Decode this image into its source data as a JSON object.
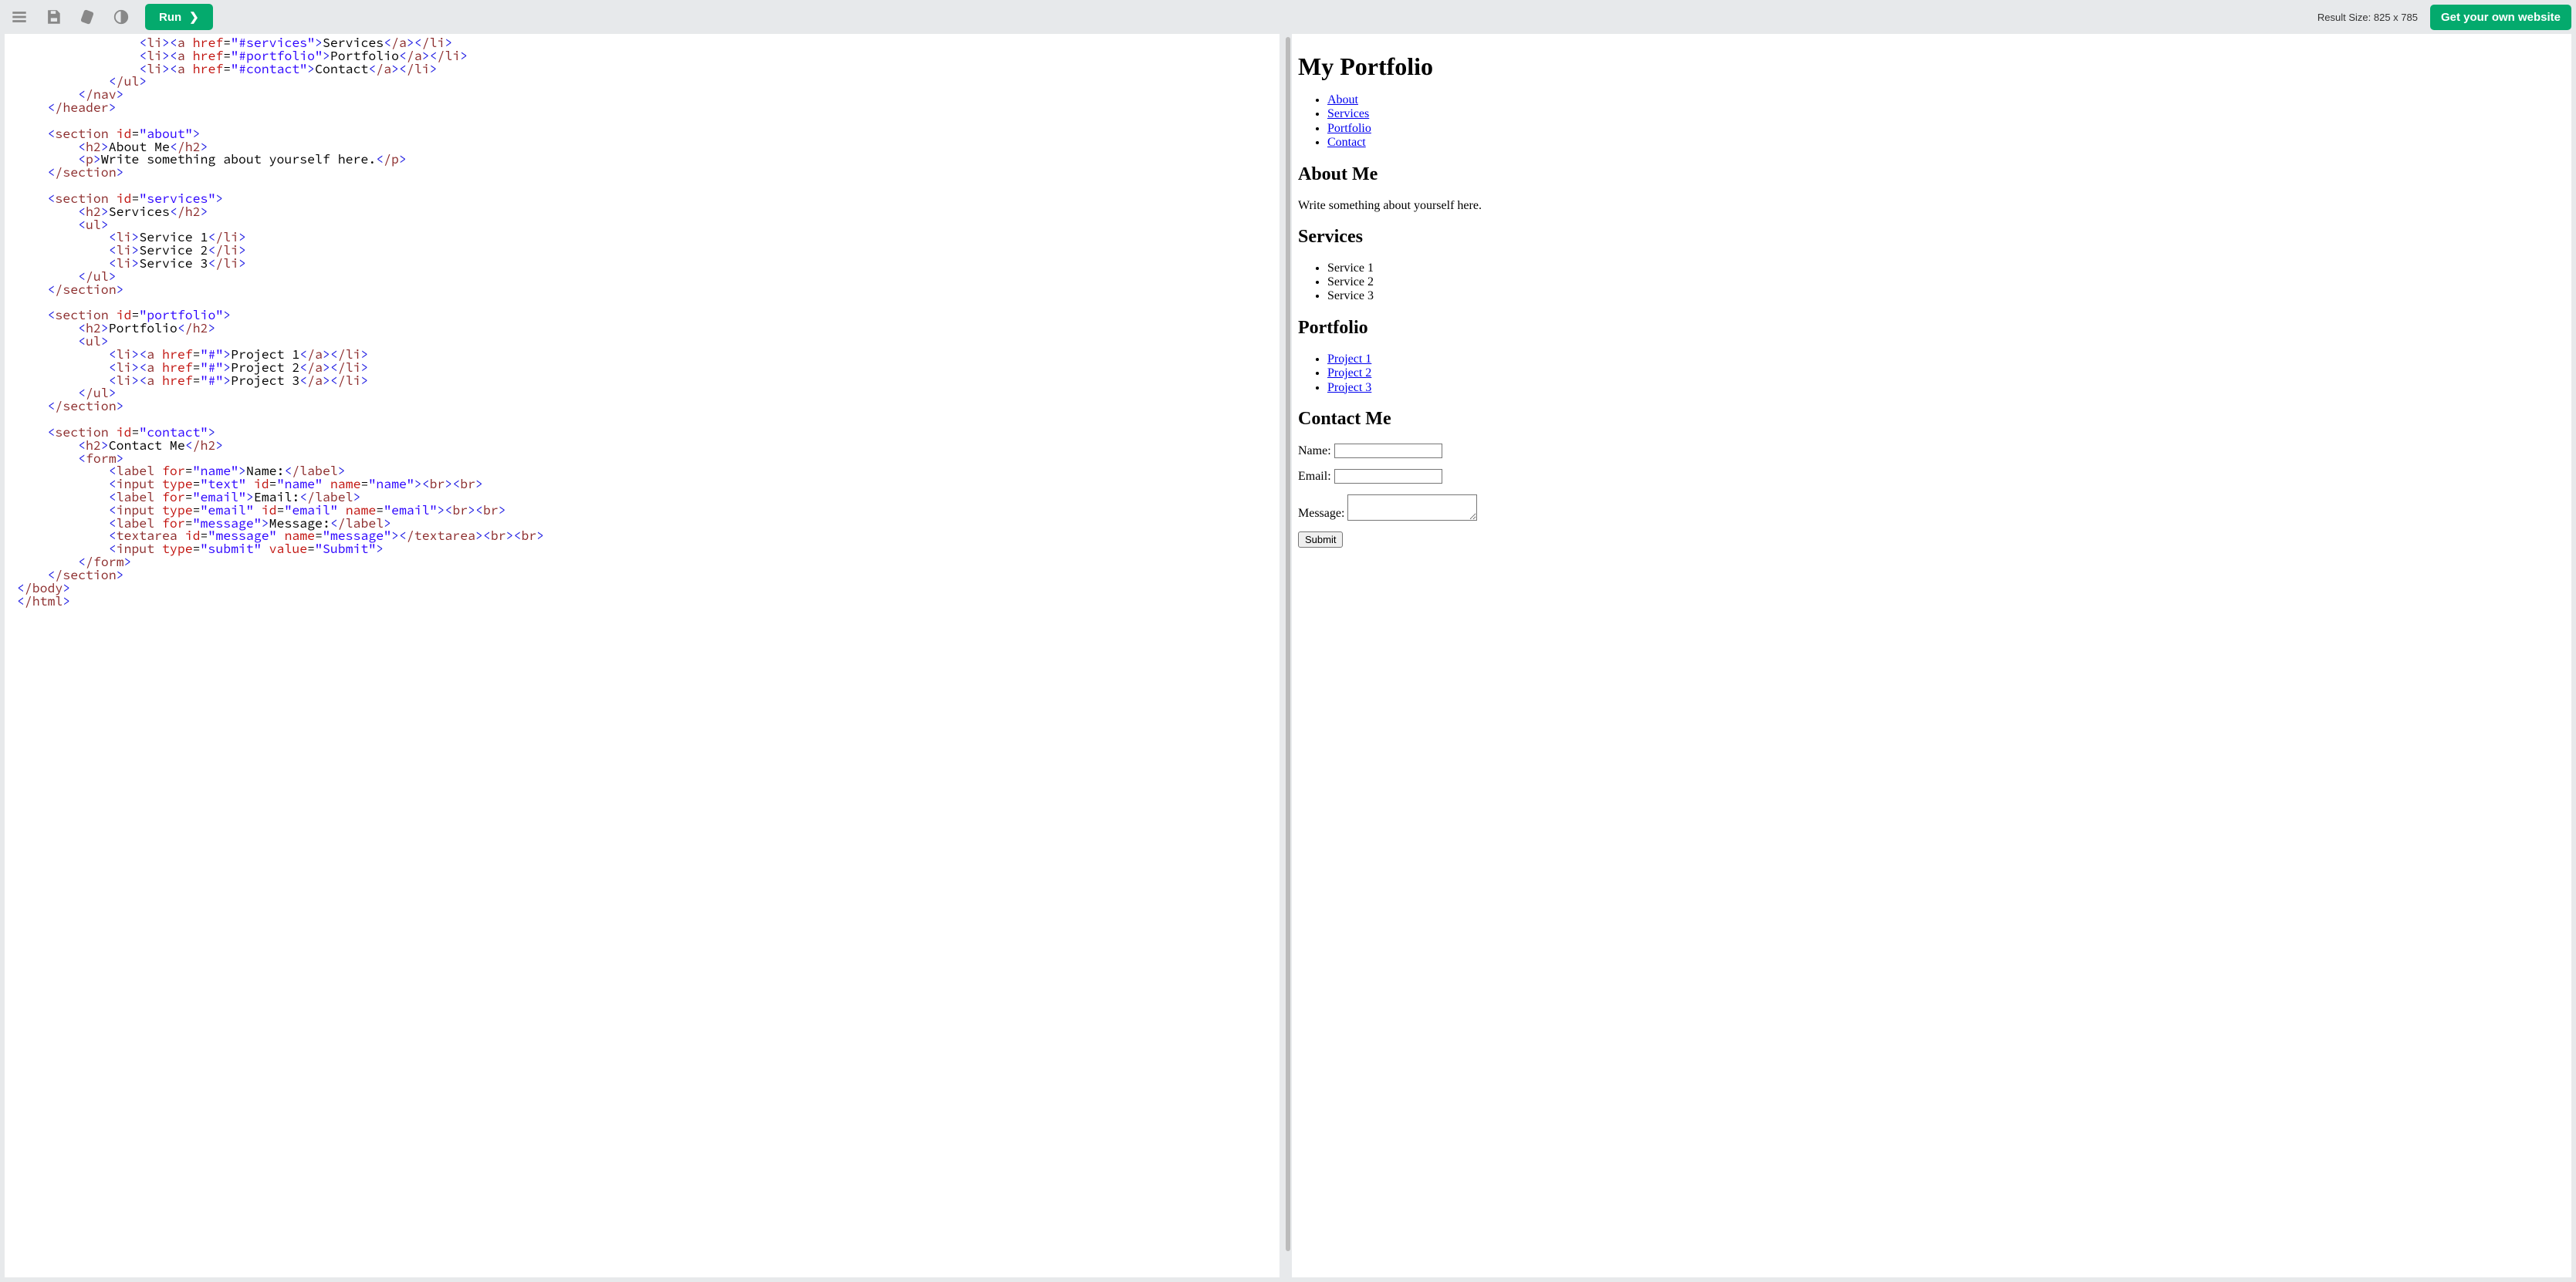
{
  "toolbar": {
    "run_label": "Run",
    "run_chevron": "❯",
    "result_size_label": "Result Size: 825 x 785",
    "get_own_label": "Get your own website"
  },
  "code": {
    "lines": [
      [
        4,
        "<",
        "li",
        "><",
        "a",
        " ",
        [
          "href"
        ],
        "=",
        "\"#services\"",
        ">",
        "Services",
        "</",
        "a",
        "></",
        "li",
        ">"
      ],
      [
        4,
        "<",
        "li",
        "><",
        "a",
        " ",
        [
          "href"
        ],
        "=",
        "\"#portfolio\"",
        ">",
        "Portfolio",
        "</",
        "a",
        "></",
        "li",
        ">"
      ],
      [
        4,
        "<",
        "li",
        "><",
        "a",
        " ",
        [
          "href"
        ],
        "=",
        "\"#contact\"",
        ">",
        "Contact",
        "</",
        "a",
        "></",
        "li",
        ">"
      ],
      [
        3,
        "</",
        "ul",
        ">"
      ],
      [
        2,
        "</",
        "nav",
        ">"
      ],
      [
        1,
        "</",
        "header",
        ">"
      ],
      [
        0,
        ""
      ],
      [
        1,
        "<",
        "section",
        " ",
        [
          "id"
        ],
        "=",
        "\"about\"",
        ">"
      ],
      [
        2,
        "<",
        "h2",
        ">",
        "About Me",
        "</",
        "h2",
        ">"
      ],
      [
        2,
        "<",
        "p",
        ">",
        "Write something about yourself here.",
        "</",
        "p",
        ">"
      ],
      [
        1,
        "</",
        "section",
        ">"
      ],
      [
        0,
        ""
      ],
      [
        1,
        "<",
        "section",
        " ",
        [
          "id"
        ],
        "=",
        "\"services\"",
        ">"
      ],
      [
        2,
        "<",
        "h2",
        ">",
        "Services",
        "</",
        "h2",
        ">"
      ],
      [
        2,
        "<",
        "ul",
        ">"
      ],
      [
        3,
        "<",
        "li",
        ">",
        "Service 1",
        "</",
        "li",
        ">"
      ],
      [
        3,
        "<",
        "li",
        ">",
        "Service 2",
        "</",
        "li",
        ">"
      ],
      [
        3,
        "<",
        "li",
        ">",
        "Service 3",
        "</",
        "li",
        ">"
      ],
      [
        2,
        "</",
        "ul",
        ">"
      ],
      [
        1,
        "</",
        "section",
        ">"
      ],
      [
        0,
        ""
      ],
      [
        1,
        "<",
        "section",
        " ",
        [
          "id"
        ],
        "=",
        "\"portfolio\"",
        ">"
      ],
      [
        2,
        "<",
        "h2",
        ">",
        "Portfolio",
        "</",
        "h2",
        ">"
      ],
      [
        2,
        "<",
        "ul",
        ">"
      ],
      [
        3,
        "<",
        "li",
        "><",
        "a",
        " ",
        [
          "href"
        ],
        "=",
        "\"#\"",
        ">",
        "Project 1",
        "</",
        "a",
        "></",
        "li",
        ">"
      ],
      [
        3,
        "<",
        "li",
        "><",
        "a",
        " ",
        [
          "href"
        ],
        "=",
        "\"#\"",
        ">",
        "Project 2",
        "</",
        "a",
        "></",
        "li",
        ">"
      ],
      [
        3,
        "<",
        "li",
        "><",
        "a",
        " ",
        [
          "href"
        ],
        "=",
        "\"#\"",
        ">",
        "Project 3",
        "</",
        "a",
        "></",
        "li",
        ">"
      ],
      [
        2,
        "</",
        "ul",
        ">"
      ],
      [
        1,
        "</",
        "section",
        ">"
      ],
      [
        0,
        ""
      ],
      [
        1,
        "<",
        "section",
        " ",
        [
          "id"
        ],
        "=",
        "\"contact\"",
        ">"
      ],
      [
        2,
        "<",
        "h2",
        ">",
        "Contact Me",
        "</",
        "h2",
        ">"
      ],
      [
        2,
        "<",
        "form",
        ">"
      ],
      [
        3,
        "<",
        "label",
        " ",
        [
          "for"
        ],
        "=",
        "\"name\"",
        ">",
        "Name:",
        "</",
        "label",
        ">"
      ],
      [
        3,
        "<",
        "input",
        " ",
        [
          "type"
        ],
        "=",
        "\"text\"",
        " ",
        [
          "id"
        ],
        "=",
        "\"name\"",
        " ",
        [
          "name"
        ],
        "=",
        "\"name\"",
        "><",
        "br",
        "><",
        "br",
        ">"
      ],
      [
        3,
        "<",
        "label",
        " ",
        [
          "for"
        ],
        "=",
        "\"email\"",
        ">",
        "Email:",
        "</",
        "label",
        ">"
      ],
      [
        3,
        "<",
        "input",
        " ",
        [
          "type"
        ],
        "=",
        "\"email\"",
        " ",
        [
          "id"
        ],
        "=",
        "\"email\"",
        " ",
        [
          "name"
        ],
        "=",
        "\"email\"",
        "><",
        "br",
        "><",
        "br",
        ">"
      ],
      [
        3,
        "<",
        "label",
        " ",
        [
          "for"
        ],
        "=",
        "\"message\"",
        ">",
        "Message:",
        "</",
        "label",
        ">"
      ],
      [
        3,
        "<",
        "textarea",
        " ",
        [
          "id"
        ],
        "=",
        "\"message\"",
        " ",
        [
          "name"
        ],
        "=",
        "\"message\"",
        "></",
        "textarea",
        "><",
        "br",
        "><",
        "br",
        ">"
      ],
      [
        3,
        "<",
        "input",
        " ",
        [
          "type"
        ],
        "=",
        "\"submit\"",
        " ",
        [
          "value"
        ],
        "=",
        "\"Submit\"",
        ">"
      ],
      [
        2,
        "</",
        "form",
        ">"
      ],
      [
        1,
        "</",
        "section",
        ">"
      ],
      [
        0,
        "</",
        "body",
        ">"
      ],
      [
        0,
        "</",
        "html",
        ">"
      ]
    ]
  },
  "preview": {
    "h1": "My Portfolio",
    "nav": [
      "About",
      "Services",
      "Portfolio",
      "Contact"
    ],
    "about": {
      "heading": "About Me",
      "text": "Write something about yourself here."
    },
    "services": {
      "heading": "Services",
      "items": [
        "Service 1",
        "Service 2",
        "Service 3"
      ]
    },
    "portfolio": {
      "heading": "Portfolio",
      "items": [
        "Project 1",
        "Project 2",
        "Project 3"
      ]
    },
    "contact": {
      "heading": "Contact Me",
      "name_label": "Name:",
      "email_label": "Email:",
      "message_label": "Message:",
      "submit_label": "Submit"
    }
  }
}
